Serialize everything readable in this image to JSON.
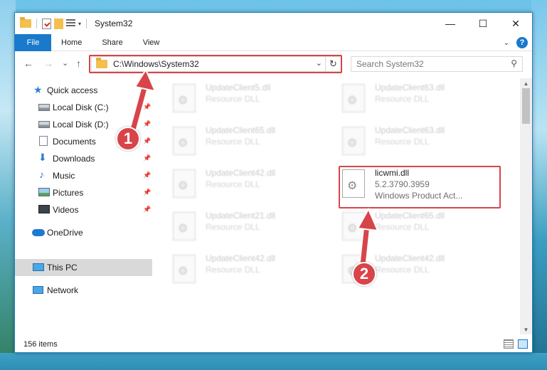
{
  "window": {
    "title": "System32",
    "quick_access_toolbar": [
      "folder-icon",
      "properties-icon",
      "new-folder-icon",
      "customize-icon"
    ],
    "controls": {
      "minimize": "—",
      "maximize": "☐",
      "close": "✕"
    }
  },
  "ribbon": {
    "tabs": [
      "File",
      "Home",
      "Share",
      "View"
    ],
    "expand_glyph": "⌄",
    "help_glyph": "?"
  },
  "navigation": {
    "back": "←",
    "forward": "→",
    "recent": "⌄",
    "up": "↑",
    "address": "C:\\Windows\\System32",
    "dropdown_glyph": "⌄",
    "refresh_glyph": "↻",
    "search_placeholder": "Search System32",
    "search_glyph": "⚲"
  },
  "sidebar": {
    "items": [
      {
        "label": "Quick access",
        "icon": "star-icon"
      },
      {
        "label": "Local Disk (C:)",
        "icon": "disk-icon",
        "pinned": true
      },
      {
        "label": "Local Disk (D:)",
        "icon": "disk-icon",
        "pinned": true
      },
      {
        "label": "Documents",
        "icon": "documents-icon",
        "pinned": true
      },
      {
        "label": "Downloads",
        "icon": "downloads-icon",
        "pinned": true
      },
      {
        "label": "Music",
        "icon": "music-icon",
        "pinned": true
      },
      {
        "label": "Pictures",
        "icon": "pictures-icon",
        "pinned": true
      },
      {
        "label": "Videos",
        "icon": "videos-icon",
        "pinned": true
      },
      {
        "label": "OneDrive",
        "icon": "cloud-icon"
      },
      {
        "label": "This PC",
        "icon": "computer-icon",
        "selected": true
      },
      {
        "label": "Network",
        "icon": "network-icon"
      }
    ],
    "pin_glyph": "📌"
  },
  "files": [
    {
      "name": "UpdateClient5.dll",
      "type": "Resource DLL"
    },
    {
      "name": "UpdateClient63.dll",
      "type": "Resource DLL"
    },
    {
      "name": "UpdateClient65.dll",
      "type": "Resource DLL"
    },
    {
      "name": "UpdateClient63.dll",
      "type": "Resource DLL"
    },
    {
      "name": "UpdateClient42.dll",
      "type": "Resource DLL"
    },
    {
      "name": "licwmi.dll",
      "type": "5.2.3790.3959",
      "description": "Windows Product Act...",
      "highlighted": true
    },
    {
      "name": "UpdateClient21.dll",
      "type": "Resource DLL"
    },
    {
      "name": "UpdateClient65.dll",
      "type": "Resource DLL"
    },
    {
      "name": "UpdateClient42.dll",
      "type": "Resource DLL"
    },
    {
      "name": "UpdateClient42.dll",
      "type": "Resource DLL"
    }
  ],
  "status": {
    "item_count": "156 items"
  },
  "annotations": {
    "markers": [
      "1",
      "2"
    ],
    "color": "#d8444a"
  },
  "colors": {
    "accent": "#1979ca",
    "highlight": "#d8444a"
  }
}
